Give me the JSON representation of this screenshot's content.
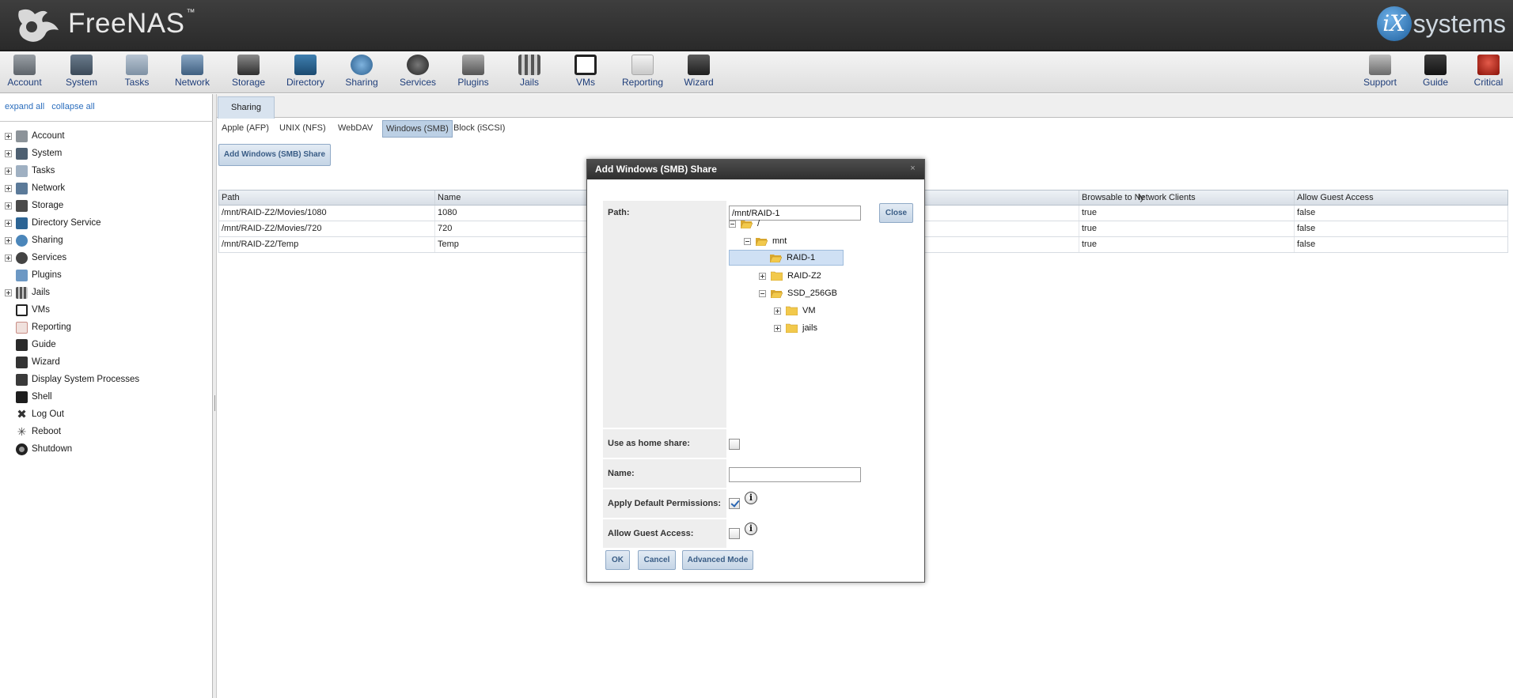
{
  "header": {
    "brand_name": "FreeNAS",
    "brand_tm": "™",
    "vendor_ix": "iX",
    "vendor_text": "systems"
  },
  "toolbar": {
    "items": [
      {
        "label": "Account",
        "icon": "account-icon"
      },
      {
        "label": "System",
        "icon": "system-icon"
      },
      {
        "label": "Tasks",
        "icon": "tasks-icon"
      },
      {
        "label": "Network",
        "icon": "network-icon"
      },
      {
        "label": "Storage",
        "icon": "storage-icon"
      },
      {
        "label": "Directory",
        "icon": "directory-icon"
      },
      {
        "label": "Sharing",
        "icon": "sharing-icon"
      },
      {
        "label": "Services",
        "icon": "services-icon"
      },
      {
        "label": "Plugins",
        "icon": "plugins-icon"
      },
      {
        "label": "Jails",
        "icon": "jails-icon"
      },
      {
        "label": "VMs",
        "icon": "vms-icon"
      },
      {
        "label": "Reporting",
        "icon": "reporting-icon"
      },
      {
        "label": "Wizard",
        "icon": "wizard-icon"
      }
    ],
    "right_items": [
      {
        "label": "Support",
        "icon": "support-icon"
      },
      {
        "label": "Guide",
        "icon": "guide-icon"
      },
      {
        "label": "Critical",
        "icon": "critical-alert-icon"
      }
    ]
  },
  "sidebar": {
    "expand_all": "expand all",
    "collapse_all": "collapse all",
    "items": [
      {
        "label": "Account",
        "expandable": true
      },
      {
        "label": "System",
        "expandable": true
      },
      {
        "label": "Tasks",
        "expandable": true
      },
      {
        "label": "Network",
        "expandable": true
      },
      {
        "label": "Storage",
        "expandable": true
      },
      {
        "label": "Directory Service",
        "expandable": true
      },
      {
        "label": "Sharing",
        "expandable": true
      },
      {
        "label": "Services",
        "expandable": true
      },
      {
        "label": "Plugins",
        "expandable": false
      },
      {
        "label": "Jails",
        "expandable": true
      },
      {
        "label": "VMs",
        "expandable": false
      },
      {
        "label": "Reporting",
        "expandable": false
      },
      {
        "label": "Guide",
        "expandable": false
      },
      {
        "label": "Wizard",
        "expandable": false
      },
      {
        "label": "Display System Processes",
        "expandable": false
      },
      {
        "label": "Shell",
        "expandable": false
      },
      {
        "label": "Log Out",
        "expandable": false
      },
      {
        "label": "Reboot",
        "expandable": false
      },
      {
        "label": "Shutdown",
        "expandable": false
      }
    ]
  },
  "main": {
    "tab": "Sharing",
    "subtabs": [
      "Apple (AFP)",
      "UNIX (NFS)",
      "WebDAV",
      "Windows (SMB)",
      "Block (iSCSI)"
    ],
    "active_subtab": "Windows (SMB)",
    "add_button": "Add Windows (SMB) Share",
    "columns": [
      "Path",
      "Name",
      "ly",
      "Browsable to Network Clients",
      "Allow Guest Access"
    ],
    "rows": [
      {
        "path": "/mnt/RAID-Z2/Movies/1080",
        "name": "1080",
        "browsable": "true",
        "guest": "false"
      },
      {
        "path": "/mnt/RAID-Z2/Movies/720",
        "name": "720",
        "browsable": "true",
        "guest": "false"
      },
      {
        "path": "/mnt/RAID-Z2/Temp",
        "name": "Temp",
        "browsable": "true",
        "guest": "false"
      }
    ]
  },
  "dialog": {
    "title": "Add Windows (SMB) Share",
    "close_glyph": "×",
    "path_label": "Path:",
    "path_value": "/mnt/RAID-1",
    "close_button": "Close",
    "tree": [
      {
        "label": "/",
        "expander": "minus",
        "open": true
      },
      {
        "label": "mnt",
        "expander": "minus",
        "open": true
      },
      {
        "label": "RAID-1",
        "expander": "none",
        "open": true,
        "selected": true
      },
      {
        "label": "RAID-Z2",
        "expander": "plus",
        "open": false
      },
      {
        "label": "SSD_256GB",
        "expander": "minus",
        "open": true
      },
      {
        "label": "VM",
        "expander": "plus",
        "open": false
      },
      {
        "label": "jails",
        "expander": "plus",
        "open": false
      }
    ],
    "home_share_label": "Use as home share:",
    "home_share_checked": false,
    "name_label": "Name:",
    "name_value": "",
    "default_perms_label": "Apply Default Permissions:",
    "default_perms_checked": true,
    "guest_label": "Allow Guest Access:",
    "guest_checked": false,
    "info_glyph": "i",
    "ok_button": "OK",
    "cancel_button": "Cancel",
    "advanced_button": "Advanced Mode"
  },
  "colors": {
    "header_bg": "#333333",
    "link_blue": "#2a6dbd",
    "button_text": "#3a5d86",
    "selected_row": "#cfe0f4",
    "folder_yellow": "#f2c94c"
  }
}
